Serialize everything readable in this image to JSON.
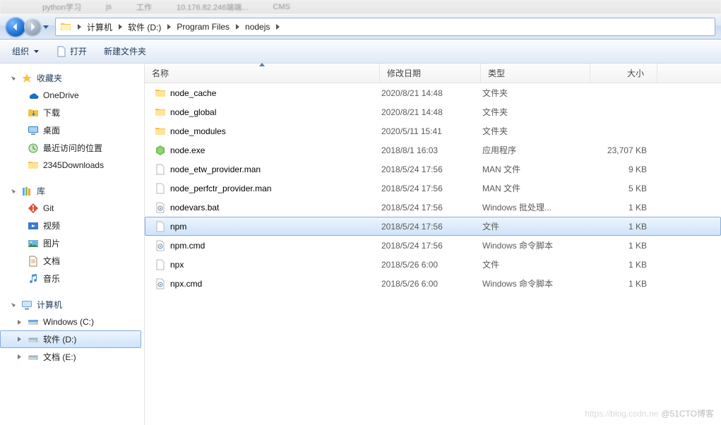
{
  "tabs_hint": [
    "python学习",
    "js",
    "工作",
    "10.176.82.246端端...",
    "CMS"
  ],
  "breadcrumb": {
    "root_icon": "computer",
    "segments": [
      "计算机",
      "软件 (D:)",
      "Program Files",
      "nodejs"
    ]
  },
  "toolbar": {
    "organize_label": "组织",
    "open_label": "打开",
    "new_folder_label": "新建文件夹"
  },
  "sidebar": {
    "favorites": {
      "title": "收藏夹",
      "items": [
        {
          "icon": "onedrive",
          "label": "OneDrive"
        },
        {
          "icon": "downloads",
          "label": "下载"
        },
        {
          "icon": "desktop",
          "label": "桌面"
        },
        {
          "icon": "recent",
          "label": "最近访问的位置"
        },
        {
          "icon": "folder",
          "label": "2345Downloads"
        }
      ]
    },
    "libraries": {
      "title": "库",
      "items": [
        {
          "icon": "git",
          "label": "Git"
        },
        {
          "icon": "video",
          "label": "视频"
        },
        {
          "icon": "pictures",
          "label": "图片"
        },
        {
          "icon": "documents",
          "label": "文档"
        },
        {
          "icon": "music",
          "label": "音乐"
        }
      ]
    },
    "computer": {
      "title": "计算机",
      "items": [
        {
          "icon": "drive-c",
          "label": "Windows (C:)",
          "expand": true
        },
        {
          "icon": "drive",
          "label": "软件 (D:)",
          "selected": true,
          "expand": true
        },
        {
          "icon": "drive",
          "label": "文档 (E:)",
          "expand": true
        }
      ]
    }
  },
  "columns": {
    "name": "名称",
    "date": "修改日期",
    "type": "类型",
    "size": "大小",
    "sorted": "name",
    "dir": "asc"
  },
  "files": [
    {
      "icon": "folder",
      "name": "node_cache",
      "date": "2020/8/21 14:48",
      "type": "文件夹",
      "size": ""
    },
    {
      "icon": "folder",
      "name": "node_global",
      "date": "2020/8/21 14:48",
      "type": "文件夹",
      "size": ""
    },
    {
      "icon": "folder",
      "name": "node_modules",
      "date": "2020/5/11 15:41",
      "type": "文件夹",
      "size": ""
    },
    {
      "icon": "node",
      "name": "node.exe",
      "date": "2018/8/1 16:03",
      "type": "应用程序",
      "size": "23,707 KB"
    },
    {
      "icon": "file",
      "name": "node_etw_provider.man",
      "date": "2018/5/24 17:56",
      "type": "MAN 文件",
      "size": "9 KB"
    },
    {
      "icon": "file",
      "name": "node_perfctr_provider.man",
      "date": "2018/5/24 17:56",
      "type": "MAN 文件",
      "size": "5 KB"
    },
    {
      "icon": "bat",
      "name": "nodevars.bat",
      "date": "2018/5/24 17:56",
      "type": "Windows 批处理...",
      "size": "1 KB"
    },
    {
      "icon": "file",
      "name": "npm",
      "date": "2018/5/24 17:56",
      "type": "文件",
      "size": "1 KB",
      "selected": true
    },
    {
      "icon": "bat",
      "name": "npm.cmd",
      "date": "2018/5/24 17:56",
      "type": "Windows 命令脚本",
      "size": "1 KB"
    },
    {
      "icon": "file",
      "name": "npx",
      "date": "2018/5/26 6:00",
      "type": "文件",
      "size": "1 KB"
    },
    {
      "icon": "bat",
      "name": "npx.cmd",
      "date": "2018/5/26 6:00",
      "type": "Windows 命令脚本",
      "size": "1 KB"
    }
  ],
  "watermark": {
    "faint": "https://blog.csdn.ne",
    "bold": "@51CTO博客"
  }
}
